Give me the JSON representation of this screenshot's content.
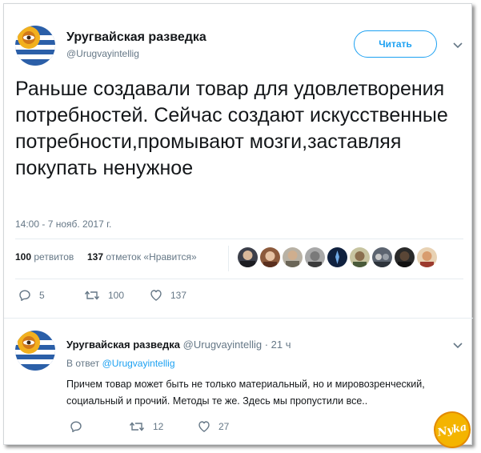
{
  "colors": {
    "accent": "#1da1f2",
    "text": "#14171a",
    "muted": "#657786",
    "divider": "#e6ecf0"
  },
  "main_tweet": {
    "display_name": "Уругвайская разведка",
    "handle": "@Urugvayintellig",
    "follow_label": "Читать",
    "text": "Раньше создавали товар для удовлетворения потребностей. Сейчас создают искусственные потребности,промывают мозги,заставляя покупать ненужное",
    "timestamp": "14:00 - 7 нояб. 2017 г.",
    "stats": {
      "retweets_count": "100",
      "retweets_label": "ретвитов",
      "likes_count": "137",
      "likes_label": "отметок «Нравится»"
    },
    "liker_avatars": 9,
    "actions": {
      "reply_count": "5",
      "retweet_count": "100",
      "like_count": "137"
    }
  },
  "reply_tweet": {
    "display_name": "Уругвайская разведка",
    "handle_time": "@Urugvayintellig · 21 ч",
    "reply_to_label": "В ответ",
    "reply_to_handle": "@Urugvayintellig",
    "text": "Причем товар может быть не только материальный, но и мировозренческий, социальный и прочий. Методы те же. Здесь мы пропустили все..",
    "actions": {
      "reply_count": "",
      "retweet_count": "12",
      "like_count": "27"
    }
  },
  "watermark_text": "Nyka",
  "icons": {
    "reply": "reply-icon",
    "retweet": "retweet-icon",
    "like": "heart-icon",
    "menu": "chevron-down-icon"
  }
}
